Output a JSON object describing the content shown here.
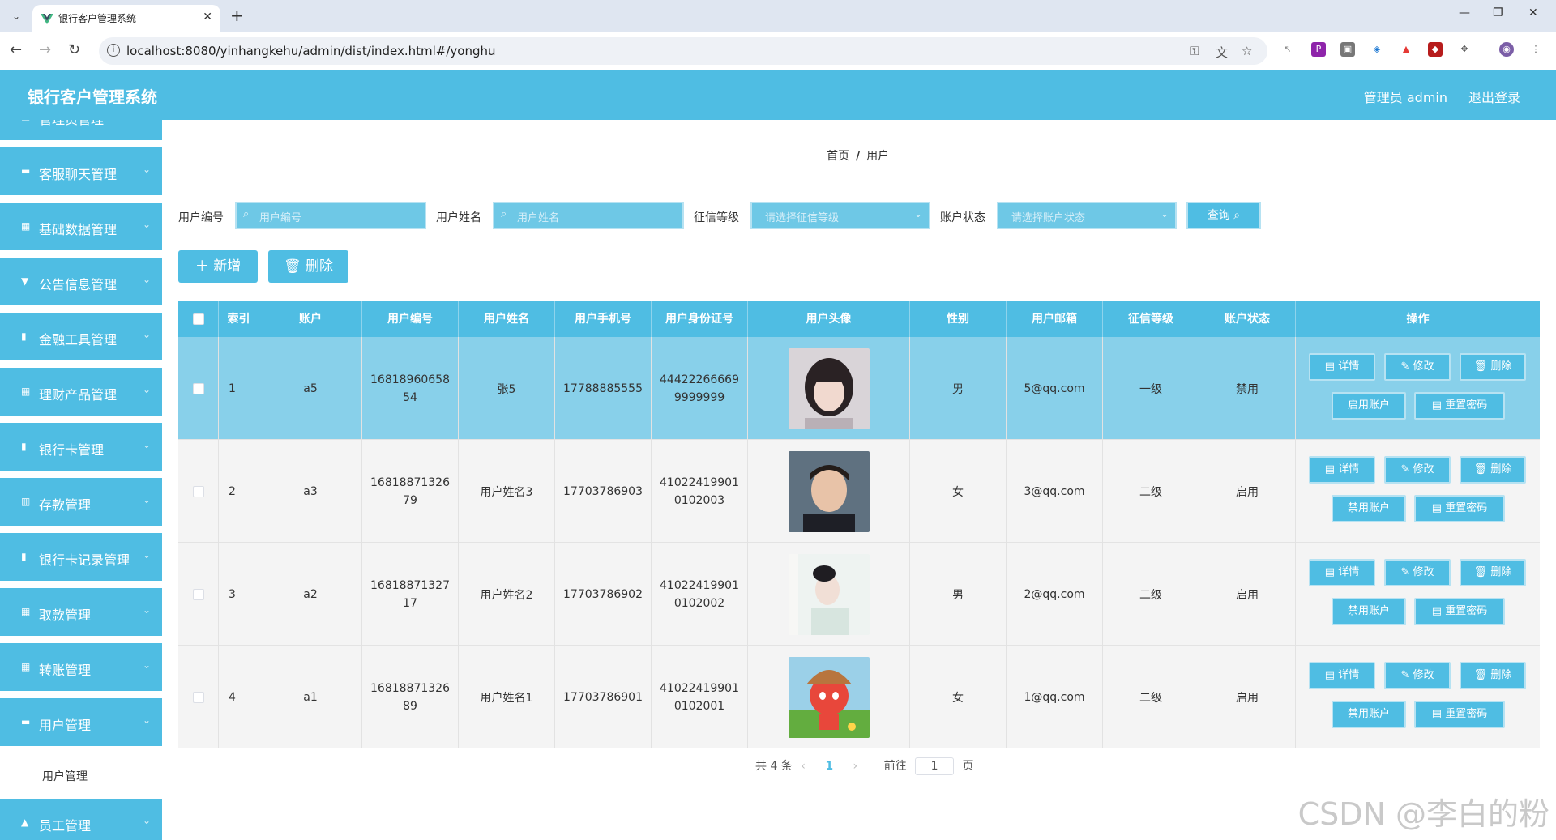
{
  "browser": {
    "tab_title": "银行客户管理系统",
    "url": "localhost:8080/yinhangkehu/admin/dist/index.html#/yonghu"
  },
  "app": {
    "title": "银行客户管理系统",
    "admin_label": "管理员 admin",
    "logout_label": "退出登录"
  },
  "sidebar": {
    "items": [
      {
        "label": "管理员管理"
      },
      {
        "label": "客服聊天管理"
      },
      {
        "label": "基础数据管理"
      },
      {
        "label": "公告信息管理"
      },
      {
        "label": "金融工具管理"
      },
      {
        "label": "理财产品管理"
      },
      {
        "label": "银行卡管理"
      },
      {
        "label": "存款管理"
      },
      {
        "label": "银行卡记录管理"
      },
      {
        "label": "取款管理"
      },
      {
        "label": "转账管理"
      },
      {
        "label": "用户管理"
      }
    ],
    "sub_item": "用户管理",
    "last_item": "员工管理"
  },
  "breadcrumb": {
    "home": "首页",
    "current": "用户"
  },
  "filters": {
    "user_no_label": "用户编号",
    "user_no_placeholder": "用户编号",
    "user_name_label": "用户姓名",
    "user_name_placeholder": "用户姓名",
    "credit_label": "征信等级",
    "credit_placeholder": "请选择征信等级",
    "status_label": "账户状态",
    "status_placeholder": "请选择账户状态",
    "query_label": "查询"
  },
  "actions": {
    "add_label": "新增",
    "delete_label": "删除"
  },
  "table": {
    "headers": [
      "索引",
      "账户",
      "用户编号",
      "用户姓名",
      "用户手机号",
      "用户身份证号",
      "用户头像",
      "性别",
      "用户邮箱",
      "征信等级",
      "账户状态",
      "操作"
    ],
    "rows": [
      {
        "index": "1",
        "account": "a5",
        "user_no": "16818960658\n54",
        "name": "张5",
        "phone": "17788885555",
        "id_card": "44422266669\n9999999",
        "gender": "男",
        "email": "5@qq.com",
        "credit": "一级",
        "status": "禁用",
        "toggle_label": "启用账户"
      },
      {
        "index": "2",
        "account": "a3",
        "user_no": "16818871326\n79",
        "name": "用户姓名3",
        "phone": "17703786903",
        "id_card": "41022419901\n0102003",
        "gender": "女",
        "email": "3@qq.com",
        "credit": "二级",
        "status": "启用",
        "toggle_label": "禁用账户"
      },
      {
        "index": "3",
        "account": "a2",
        "user_no": "16818871327\n17",
        "name": "用户姓名2",
        "phone": "17703786902",
        "id_card": "41022419901\n0102002",
        "gender": "男",
        "email": "2@qq.com",
        "credit": "二级",
        "status": "启用",
        "toggle_label": "禁用账户"
      },
      {
        "index": "4",
        "account": "a1",
        "user_no": "16818871326\n89",
        "name": "用户姓名1",
        "phone": "17703786901",
        "id_card": "41022419901\n0102001",
        "gender": "女",
        "email": "1@qq.com",
        "credit": "二级",
        "status": "启用",
        "toggle_label": "禁用账户"
      }
    ],
    "op_detail": "详情",
    "op_edit": "修改",
    "op_delete": "删除",
    "op_reset": "重置密码"
  },
  "pagination": {
    "total": "共 4 条",
    "current": "1",
    "goto_label": "前往",
    "goto_value": "1",
    "page_unit": "页"
  },
  "watermark": "CSDN @李白的粉"
}
